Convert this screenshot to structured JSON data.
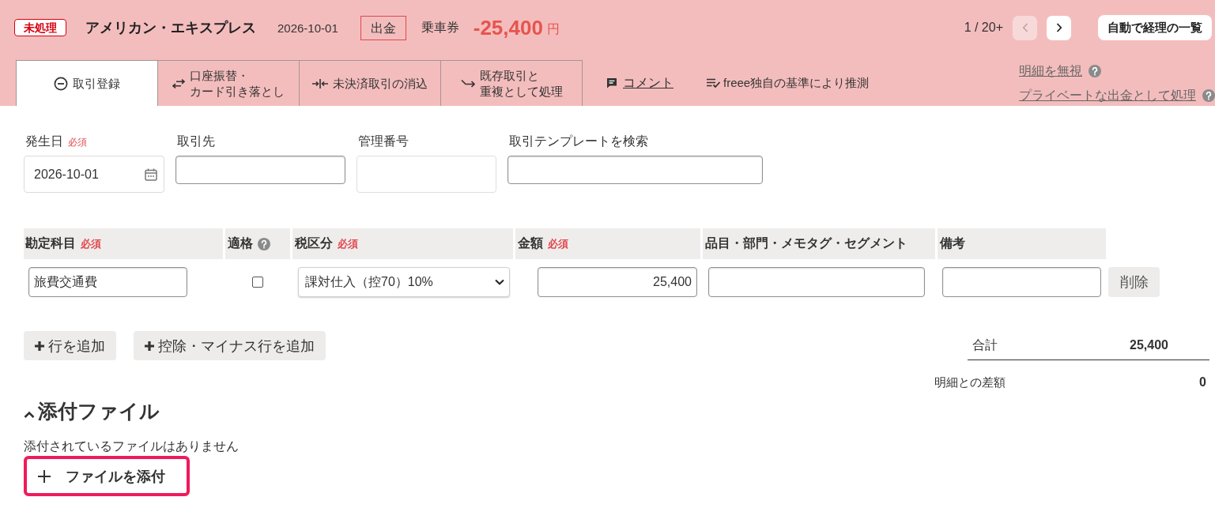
{
  "header": {
    "status_badge": "未処理",
    "account": "アメリカン・エキスプレス",
    "date": "2026-10-01",
    "direction": "出金",
    "description": "乗車券",
    "amount": "-25,400",
    "currency": "円",
    "pager": {
      "position": "1 / 20+",
      "prev_disabled": true,
      "next_disabled": false
    },
    "list_button": "自動で経理の一覧"
  },
  "tabs": [
    {
      "lines": [
        "取引登録"
      ],
      "kind": "register",
      "selected": true
    },
    {
      "lines": [
        "口座振替・",
        "カード引き落とし"
      ],
      "kind": "transfer",
      "selected": false
    },
    {
      "lines": [
        "未決済取引の消込"
      ],
      "kind": "settle",
      "selected": false
    },
    {
      "lines": [
        "既存取引と",
        "重複として処理"
      ],
      "kind": "duplicate",
      "selected": false
    }
  ],
  "actions": [
    {
      "label": "コメント",
      "kind": "comment"
    },
    {
      "label": "freee独自の基準により推測",
      "kind": "guess"
    }
  ],
  "side_links": [
    {
      "label": "明細を無視"
    },
    {
      "label": "プライベートな出金として処理"
    }
  ],
  "fields": [
    {
      "label": "発生日",
      "required": "必須",
      "kind": "date",
      "value": "2026-10-01"
    },
    {
      "label": "取引先",
      "kind": "text"
    },
    {
      "label": "管理番号",
      "kind": "plain"
    },
    {
      "label": "取引テンプレートを検索",
      "kind": "text"
    }
  ],
  "table": {
    "columns": [
      {
        "label": "勘定科目",
        "required": "必須"
      },
      {
        "label": "適格",
        "help": true
      },
      {
        "label": "税区分",
        "required": "必須"
      },
      {
        "label": "金額",
        "required": "必須"
      },
      {
        "label": "品目・部門・メモタグ・セグメント"
      },
      {
        "label": "備考"
      }
    ],
    "rows": [
      {
        "account": "旅費交通費",
        "checked": false,
        "tax": "課対仕入（控70）10%",
        "amount": "25,400",
        "delete": "削除"
      }
    ]
  },
  "add_buttons": [
    "行を追加",
    "控除・マイナス行を追加"
  ],
  "totals": [
    {
      "label": "合計",
      "value": "25,400",
      "kind": "total"
    },
    {
      "label": "明細との差額",
      "value": "0",
      "kind": "diff"
    }
  ],
  "attachments": {
    "title": "添付ファイル",
    "expanded": true,
    "empty_text": "添付されているファイルはありません",
    "button": {
      "label": "ファイルを添付",
      "highlighted": true
    }
  }
}
